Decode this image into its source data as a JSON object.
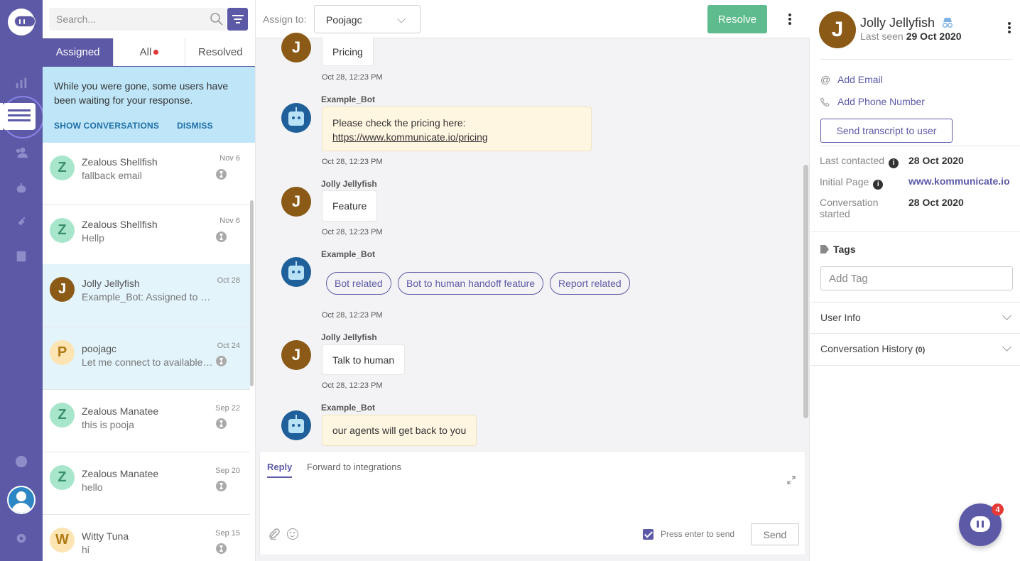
{
  "search": {
    "placeholder": "Search..."
  },
  "tabs": [
    {
      "label": "Assigned"
    },
    {
      "label": "All"
    },
    {
      "label": "Resolved"
    }
  ],
  "notice": {
    "message": "While you were gone, some users have been waiting for your response.",
    "show_label": "SHOW CONVERSATIONS",
    "dismiss_label": "DISMISS"
  },
  "conversations": [
    {
      "initial": "Z",
      "name": "Zealous Shellfish",
      "snippet": "fallback email",
      "date": "Nov 6"
    },
    {
      "initial": "Z",
      "name": "Zealous Shellfish",
      "snippet": "Hellp",
      "date": "Nov 6"
    },
    {
      "initial": "J",
      "name": "Jolly Jellyfish",
      "snippet": "Example_Bot: Assigned to Poojagc",
      "date": "Oct 28"
    },
    {
      "initial": "P",
      "name": "poojagc",
      "snippet": "Let me connect to available agents",
      "date": "Oct 24"
    },
    {
      "initial": "Z",
      "name": "Zealous Manatee",
      "snippet": "this is pooja",
      "date": "Sep 22"
    },
    {
      "initial": "Z",
      "name": "Zealous Manatee",
      "snippet": "hello",
      "date": "Sep 20"
    },
    {
      "initial": "W",
      "name": "Witty Tuna",
      "snippet": "hi",
      "date": "Sep 15"
    }
  ],
  "chat_header": {
    "assign_label": "Assign to:",
    "assignee": "Poojagc",
    "resolve_label": "Resolve"
  },
  "messages": {
    "m1": {
      "avatar": "J",
      "text": "Pricing",
      "time": "Oct 28, 12:23 PM"
    },
    "m2": {
      "sender": "Example_Bot",
      "text": "Please check the pricing here:",
      "link": "https://www.kommunicate.io/pricing",
      "time": "Oct 28, 12:23 PM"
    },
    "m3": {
      "sender": "Jolly Jellyfish",
      "avatar": "J",
      "text": "Feature",
      "time": "Oct 28, 12:23 PM"
    },
    "m4": {
      "sender": "Example_Bot",
      "chips": [
        "Bot related",
        "Bot to human handoff feature",
        "Report related"
      ],
      "time": "Oct 28, 12:23 PM"
    },
    "m5": {
      "sender": "Jolly Jellyfish",
      "avatar": "J",
      "text": "Talk to human",
      "time": "Oct 28, 12:23 PM"
    },
    "m6": {
      "sender": "Example_Bot",
      "text": "our agents will get back to you"
    }
  },
  "reply": {
    "tab_reply": "Reply",
    "tab_forward": "Forward to integrations",
    "enter_label": "Press enter to send",
    "send_label": "Send"
  },
  "user": {
    "initial": "J",
    "name": "Jolly Jellyfish",
    "last_seen_label": "Last seen",
    "last_seen": "29 Oct 2020",
    "add_email": "Add Email",
    "add_phone": "Add Phone Number",
    "transcript": "Send transcript to user",
    "last_contacted_label": "Last contacted",
    "last_contacted": "28 Oct 2020",
    "initial_page_label": "Initial Page",
    "initial_page": "www.kommunicate.io",
    "conv_started_label": "Conversation started",
    "conv_started": "28 Oct 2020"
  },
  "tags": {
    "title": "Tags",
    "placeholder": "Add Tag"
  },
  "sections": {
    "user_info": "User Info",
    "conv_history": "Conversation History",
    "conv_history_count": "(0)"
  },
  "launcher": {
    "badge": "4"
  },
  "colors": {
    "brand": "#5c5aa7",
    "resolve": "#5dbb8d",
    "notice_bg": "#bfe6f8",
    "bot_bubble": "#fff6e2",
    "badge": "#e53935"
  }
}
